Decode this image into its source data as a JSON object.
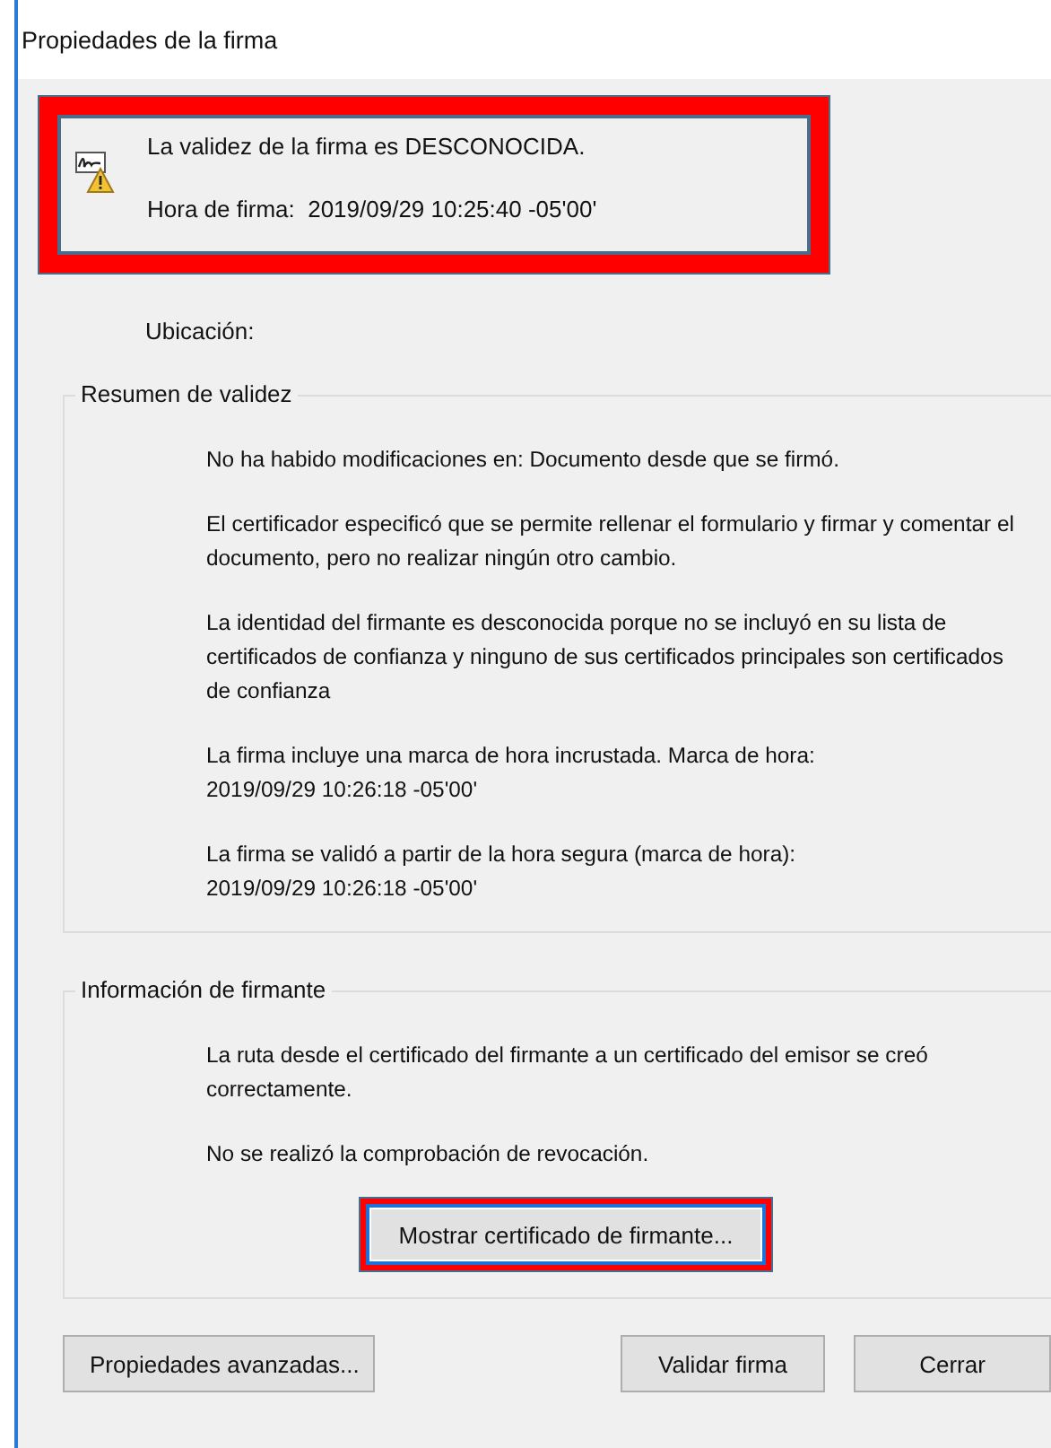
{
  "window": {
    "title": "Propiedades de la firma"
  },
  "header": {
    "highlighted": true,
    "status": "La validez de la firma es DESCONOCIDA.",
    "signing_time": "Hora de firma:  2019/09/29 10:25:40 -05'00'"
  },
  "location_label": "Ubicación:",
  "validity_summary": {
    "title": "Resumen de validez",
    "messages": [
      "No ha habido modificaciones en: Documento desde que se firmó.",
      "El certificador especificó que se permite rellenar el formulario y firmar y comentar el documento, pero no realizar ningún otro cambio.",
      "La identidad del firmante es desconocida porque no se incluyó en su lista de certificados de confianza y ninguno de sus certificados principales son certificados de confianza",
      "La firma incluye una marca de hora incrustada. Marca de hora:\n2019/09/29 10:26:18 -05'00'",
      "La firma se validó a partir de la hora segura (marca de hora):\n2019/09/29 10:26:18 -05'00'"
    ]
  },
  "signer_info": {
    "title": "Información de firmante",
    "messages": [
      "La ruta desde el certificado del firmante a un certificado del emisor se creó correctamente.",
      "No se realizó la comprobación de revocación."
    ],
    "button": {
      "label": "Mostrar certificado de firmante...",
      "highlighted": true
    }
  },
  "buttons": [
    "Propiedades avanzadas...",
    "Validar firma",
    "Cerrar"
  ]
}
